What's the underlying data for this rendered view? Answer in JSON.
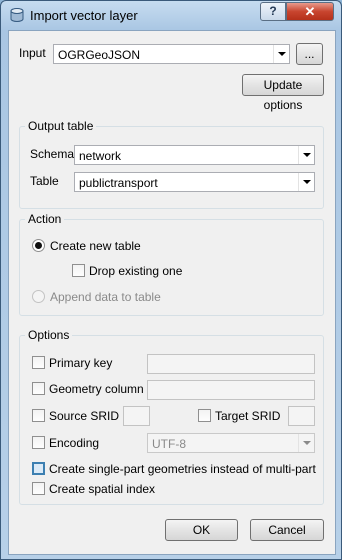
{
  "window": {
    "title": "Import vector layer",
    "help_label": "?",
    "close_label": "✕"
  },
  "input": {
    "label": "Input",
    "value": "OGRGeoJSON",
    "browse_label": "...",
    "update_label": "Update options"
  },
  "output_table": {
    "title": "Output table",
    "schema_label": "Schema",
    "schema_value": "network",
    "table_label": "Table",
    "table_value": "publictransport"
  },
  "action": {
    "title": "Action",
    "create_new": "Create new table",
    "drop_existing": "Drop existing one",
    "append": "Append data to table"
  },
  "options": {
    "title": "Options",
    "primary_key": "Primary key",
    "geometry_column": "Geometry column",
    "source_srid": "Source SRID",
    "target_srid": "Target SRID",
    "encoding": "Encoding",
    "encoding_value": "UTF-8",
    "single_part": "Create single-part geometries instead of multi-part",
    "spatial_index": "Create spatial index"
  },
  "buttons": {
    "ok": "OK",
    "cancel": "Cancel"
  }
}
